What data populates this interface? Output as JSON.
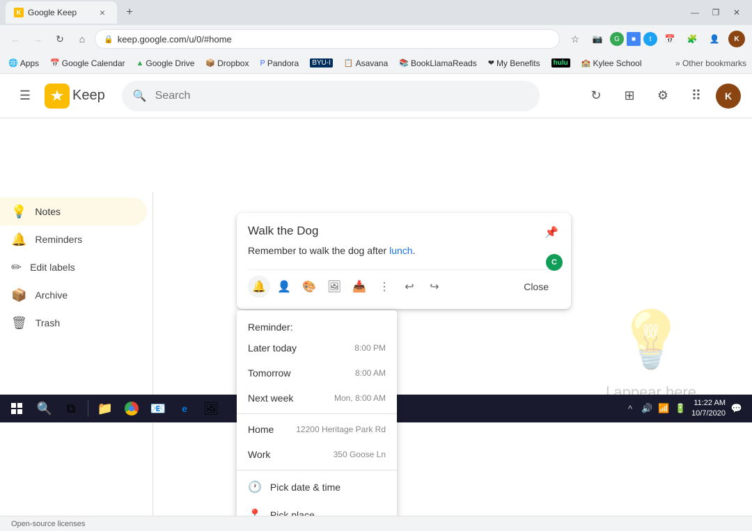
{
  "browser": {
    "tab": {
      "favicon": "K",
      "title": "Google Keep",
      "close_label": "×"
    },
    "new_tab": "+",
    "window_controls": {
      "minimize": "—",
      "maximize": "❐",
      "close": "✕"
    },
    "address_bar": {
      "back": "←",
      "forward": "→",
      "refresh": "↻",
      "home": "⌂",
      "url": "keep.google.com/u/0/#home",
      "star": "☆",
      "camera": "📷",
      "extensions_icon": "🧩",
      "profile": "👤"
    },
    "bookmarks": [
      {
        "icon": "🌐",
        "label": "Apps"
      },
      {
        "icon": "📅",
        "label": "Google Calendar"
      },
      {
        "icon": "▲",
        "label": "Google Drive"
      },
      {
        "icon": "📦",
        "label": "Dropbox"
      },
      {
        "icon": "🎵",
        "label": "Pandora"
      },
      {
        "icon": "🎓",
        "label": "BYU-I"
      },
      {
        "icon": "📋",
        "label": "Asavana"
      },
      {
        "icon": "📚",
        "label": "BookLlamaReads"
      },
      {
        "icon": "❤",
        "label": "My Benefits"
      },
      {
        "icon": "🎬",
        "label": "Hulu"
      },
      {
        "icon": "🏫",
        "label": "Kylee School"
      }
    ],
    "bookmarks_overflow": "Other bookmarks"
  },
  "app": {
    "header": {
      "hamburger": "☰",
      "logo_text": "Keep",
      "search_placeholder": "Search",
      "refresh_icon": "↻",
      "grid_icon": "⊞",
      "settings_icon": "⚙",
      "apps_icon": "⠿",
      "avatar_initials": "K"
    },
    "sidebar": {
      "items": [
        {
          "id": "notes",
          "icon": "💡",
          "label": "Notes",
          "active": true
        },
        {
          "id": "reminders",
          "icon": "🔔",
          "label": "Reminders",
          "active": false
        },
        {
          "id": "edit-labels",
          "icon": "✏",
          "label": "Edit labels",
          "active": false
        },
        {
          "id": "archive",
          "icon": "📦",
          "label": "Archive",
          "active": false
        },
        {
          "id": "trash",
          "icon": "🗑",
          "label": "Trash",
          "active": false
        }
      ]
    }
  },
  "note": {
    "title": "Walk the Dog",
    "body_prefix": "Remember to walk the dog after ",
    "body_highlight": "lunch",
    "body_suffix": ".",
    "pin_icon": "📌",
    "avatar_initials": "C",
    "toolbar": {
      "reminder_icon": "🔔",
      "add_person_icon": "👤+",
      "palette_icon": "🎨",
      "image_icon": "🖼",
      "archive_icon": "📥",
      "more_icon": "⋮",
      "undo_icon": "↩",
      "redo_icon": "↪",
      "close_label": "Close"
    }
  },
  "reminder": {
    "header": "Reminder:",
    "items": [
      {
        "label": "Later today",
        "time": "8:00 PM"
      },
      {
        "label": "Tomorrow",
        "time": "8:00 AM"
      },
      {
        "label": "Next week",
        "time": "Mon, 8:00 AM"
      },
      {
        "label": "Home",
        "address": "12200 Heritage Park Rd"
      },
      {
        "label": "Work",
        "address": "350 Goose Ln"
      }
    ],
    "actions": [
      {
        "icon": "🕐",
        "label": "Pick date & time"
      },
      {
        "icon": "📍",
        "label": "Pick place"
      }
    ]
  },
  "empty_state": {
    "text": "l appear here"
  },
  "status_bar": {
    "text": "Open-source licenses"
  },
  "taskbar": {
    "time": "11:22 AM",
    "date": "10/7/2020",
    "notification_icon": "💬"
  }
}
